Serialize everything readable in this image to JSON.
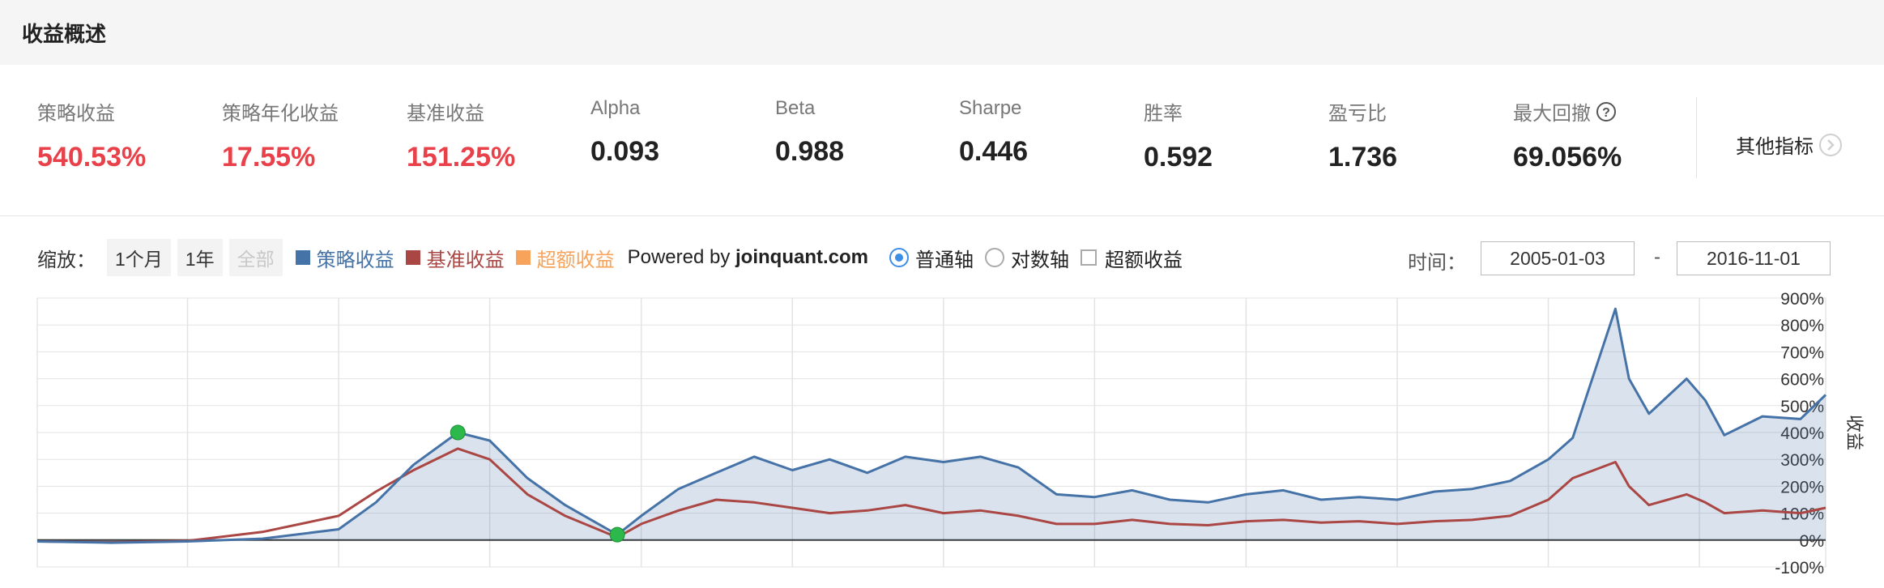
{
  "header": {
    "title": "收益概述"
  },
  "metrics": [
    {
      "label": "策略收益",
      "value": "540.53%"
    },
    {
      "label": "策略年化收益",
      "value": "17.55%"
    },
    {
      "label": "基准收益",
      "value": "151.25%"
    },
    {
      "label": "Alpha",
      "value": "0.093"
    },
    {
      "label": "Beta",
      "value": "0.988"
    },
    {
      "label": "Sharpe",
      "value": "0.446"
    },
    {
      "label": "胜率",
      "value": "0.592"
    },
    {
      "label": "盈亏比",
      "value": "1.736"
    },
    {
      "label": "最大回撤",
      "value": "69.056%"
    }
  ],
  "other_metrics": {
    "label": "其他指标"
  },
  "toolbar": {
    "zoom_label": "缩放：",
    "zoom_1m": "1个月",
    "zoom_1y": "1年",
    "zoom_all": "全部",
    "powered_prefix": "Powered by",
    "powered_site": "joinquant.com",
    "axis_normal": "普通轴",
    "axis_log": "对数轴",
    "excess_toggle": "超额收益",
    "time_label": "时间：",
    "date_from": "2005-01-03",
    "date_dash": "-",
    "date_to": "2016-11-01"
  },
  "colors": {
    "strategy": "#4572a7",
    "benchmark": "#aa4643",
    "excess": "#f7a35c",
    "negative": "#e8414a",
    "drawdown_marker": "#2db84b"
  },
  "chart_data": {
    "type": "area",
    "x_range": [
      "2005-01-03",
      "2016-11-01"
    ],
    "y_unit": "%",
    "yaxis_label": "收益",
    "ylim": [
      -100,
      900
    ],
    "yticks": [
      -100,
      0,
      100,
      200,
      300,
      400,
      500,
      600,
      700,
      800,
      900
    ],
    "ytick_labels": [
      "-100%",
      "0%",
      "100%",
      "200%",
      "300%",
      "400%",
      "500%",
      "600%",
      "700%",
      "800%",
      "900%"
    ],
    "grid": true,
    "series": [
      {
        "name": "策略收益",
        "x": [
          "2005-01-03",
          "2005-07-01",
          "2006-01-01",
          "2006-07-01",
          "2007-01-01",
          "2007-04-01",
          "2007-07-01",
          "2007-10-16",
          "2008-01-01",
          "2008-04-01",
          "2008-07-01",
          "2008-11-04",
          "2009-01-01",
          "2009-04-01",
          "2009-07-01",
          "2009-10-01",
          "2010-01-01",
          "2010-04-01",
          "2010-07-01",
          "2010-10-01",
          "2011-01-01",
          "2011-04-01",
          "2011-07-01",
          "2011-10-01",
          "2012-01-01",
          "2012-04-01",
          "2012-07-01",
          "2012-10-01",
          "2013-01-01",
          "2013-04-01",
          "2013-07-01",
          "2013-10-01",
          "2014-01-01",
          "2014-04-01",
          "2014-07-01",
          "2014-10-01",
          "2015-01-01",
          "2015-03-01",
          "2015-06-12",
          "2015-07-15",
          "2015-09-01",
          "2015-12-01",
          "2016-01-15",
          "2016-03-01",
          "2016-06-01",
          "2016-09-01",
          "2016-11-01"
        ],
        "values": [
          -5,
          -10,
          -5,
          5,
          40,
          140,
          280,
          400,
          370,
          230,
          130,
          20,
          90,
          190,
          250,
          310,
          260,
          300,
          250,
          310,
          290,
          310,
          270,
          170,
          160,
          185,
          150,
          140,
          170,
          185,
          150,
          160,
          150,
          180,
          190,
          220,
          300,
          380,
          860,
          600,
          470,
          600,
          520,
          390,
          460,
          450,
          540
        ]
      },
      {
        "name": "基准收益",
        "x": [
          "2005-01-03",
          "2005-07-01",
          "2006-01-01",
          "2006-07-01",
          "2007-01-01",
          "2007-04-01",
          "2007-07-01",
          "2007-10-16",
          "2008-01-01",
          "2008-04-01",
          "2008-07-01",
          "2008-11-04",
          "2009-01-01",
          "2009-04-01",
          "2009-07-01",
          "2009-10-01",
          "2010-01-01",
          "2010-04-01",
          "2010-07-01",
          "2010-10-01",
          "2011-01-01",
          "2011-04-01",
          "2011-07-01",
          "2011-10-01",
          "2012-01-01",
          "2012-04-01",
          "2012-07-01",
          "2012-10-01",
          "2013-01-01",
          "2013-04-01",
          "2013-07-01",
          "2013-10-01",
          "2014-01-01",
          "2014-04-01",
          "2014-07-01",
          "2014-10-01",
          "2015-01-01",
          "2015-03-01",
          "2015-06-12",
          "2015-07-15",
          "2015-09-01",
          "2015-12-01",
          "2016-01-15",
          "2016-03-01",
          "2016-06-01",
          "2016-09-01",
          "2016-11-01"
        ],
        "values": [
          -5,
          -8,
          -3,
          30,
          90,
          180,
          260,
          340,
          300,
          170,
          90,
          10,
          60,
          110,
          150,
          140,
          120,
          100,
          110,
          130,
          100,
          110,
          90,
          60,
          60,
          75,
          60,
          55,
          70,
          75,
          65,
          70,
          60,
          70,
          75,
          90,
          150,
          230,
          290,
          200,
          130,
          170,
          140,
          100,
          110,
          100,
          120
        ]
      }
    ],
    "drawdown_markers": [
      {
        "x": "2007-10-16",
        "y": 400
      },
      {
        "x": "2008-11-04",
        "y": 20
      }
    ]
  }
}
